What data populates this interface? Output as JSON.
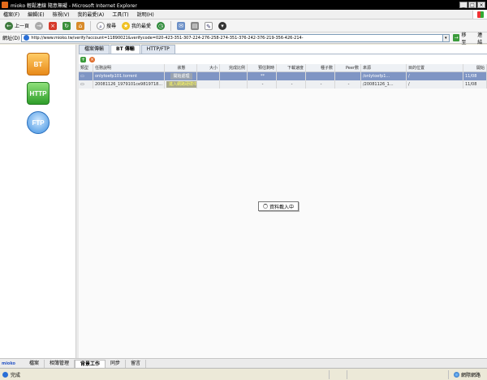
{
  "window": {
    "title": "mioko 輕鬆連線 隨意無礙 - Microsoft Internet Explorer"
  },
  "menu": [
    "檔案(F)",
    "編輯(E)",
    "檢視(V)",
    "我的最愛(A)",
    "工具(T)",
    "說明(H)"
  ],
  "toolbar": {
    "back": "上一頁",
    "search": "搜尋",
    "favorites": "我的最愛"
  },
  "address": {
    "label": "網址(D)",
    "url": "http://www.mioko.tw/verify?account=11890021&verifycode=020-423-351-307-224-276-258-274-351-376-242-376-219-356-426-214-",
    "go": "移至",
    "links": "連結"
  },
  "sidebar": {
    "bt": "BT",
    "http": "HTTP",
    "ftp": "FTP"
  },
  "tabs": [
    "檔案傳輸",
    "BT 傳輸",
    "HTTP/FTP"
  ],
  "grid": {
    "headers": [
      "類型",
      "任務說明",
      "狀態",
      "大小",
      "完成比例",
      "預估剩時",
      "下載速度",
      "種子數",
      "Peer數",
      "來源",
      "目的位置",
      "開始"
    ],
    "rows": [
      [
        "",
        "onlytoefp101.torrent",
        "開始處理",
        "",
        "",
        "**",
        "",
        "",
        "",
        "/onlytoefp1...",
        "/",
        "11/08"
      ],
      [
        "",
        "20081126_1979101ce9819718...",
        "進入網路硬碟中",
        "",
        "",
        "-",
        "-",
        "-",
        "-",
        "/20081126_1...",
        "/",
        "11/08"
      ]
    ]
  },
  "loading": "資料載入中",
  "bottom_tabs": [
    "檔案",
    "相簿管理",
    "背景工作",
    "同步",
    "留言"
  ],
  "brand": "mioko",
  "status": {
    "left": "完成",
    "zone": "網際網路"
  }
}
